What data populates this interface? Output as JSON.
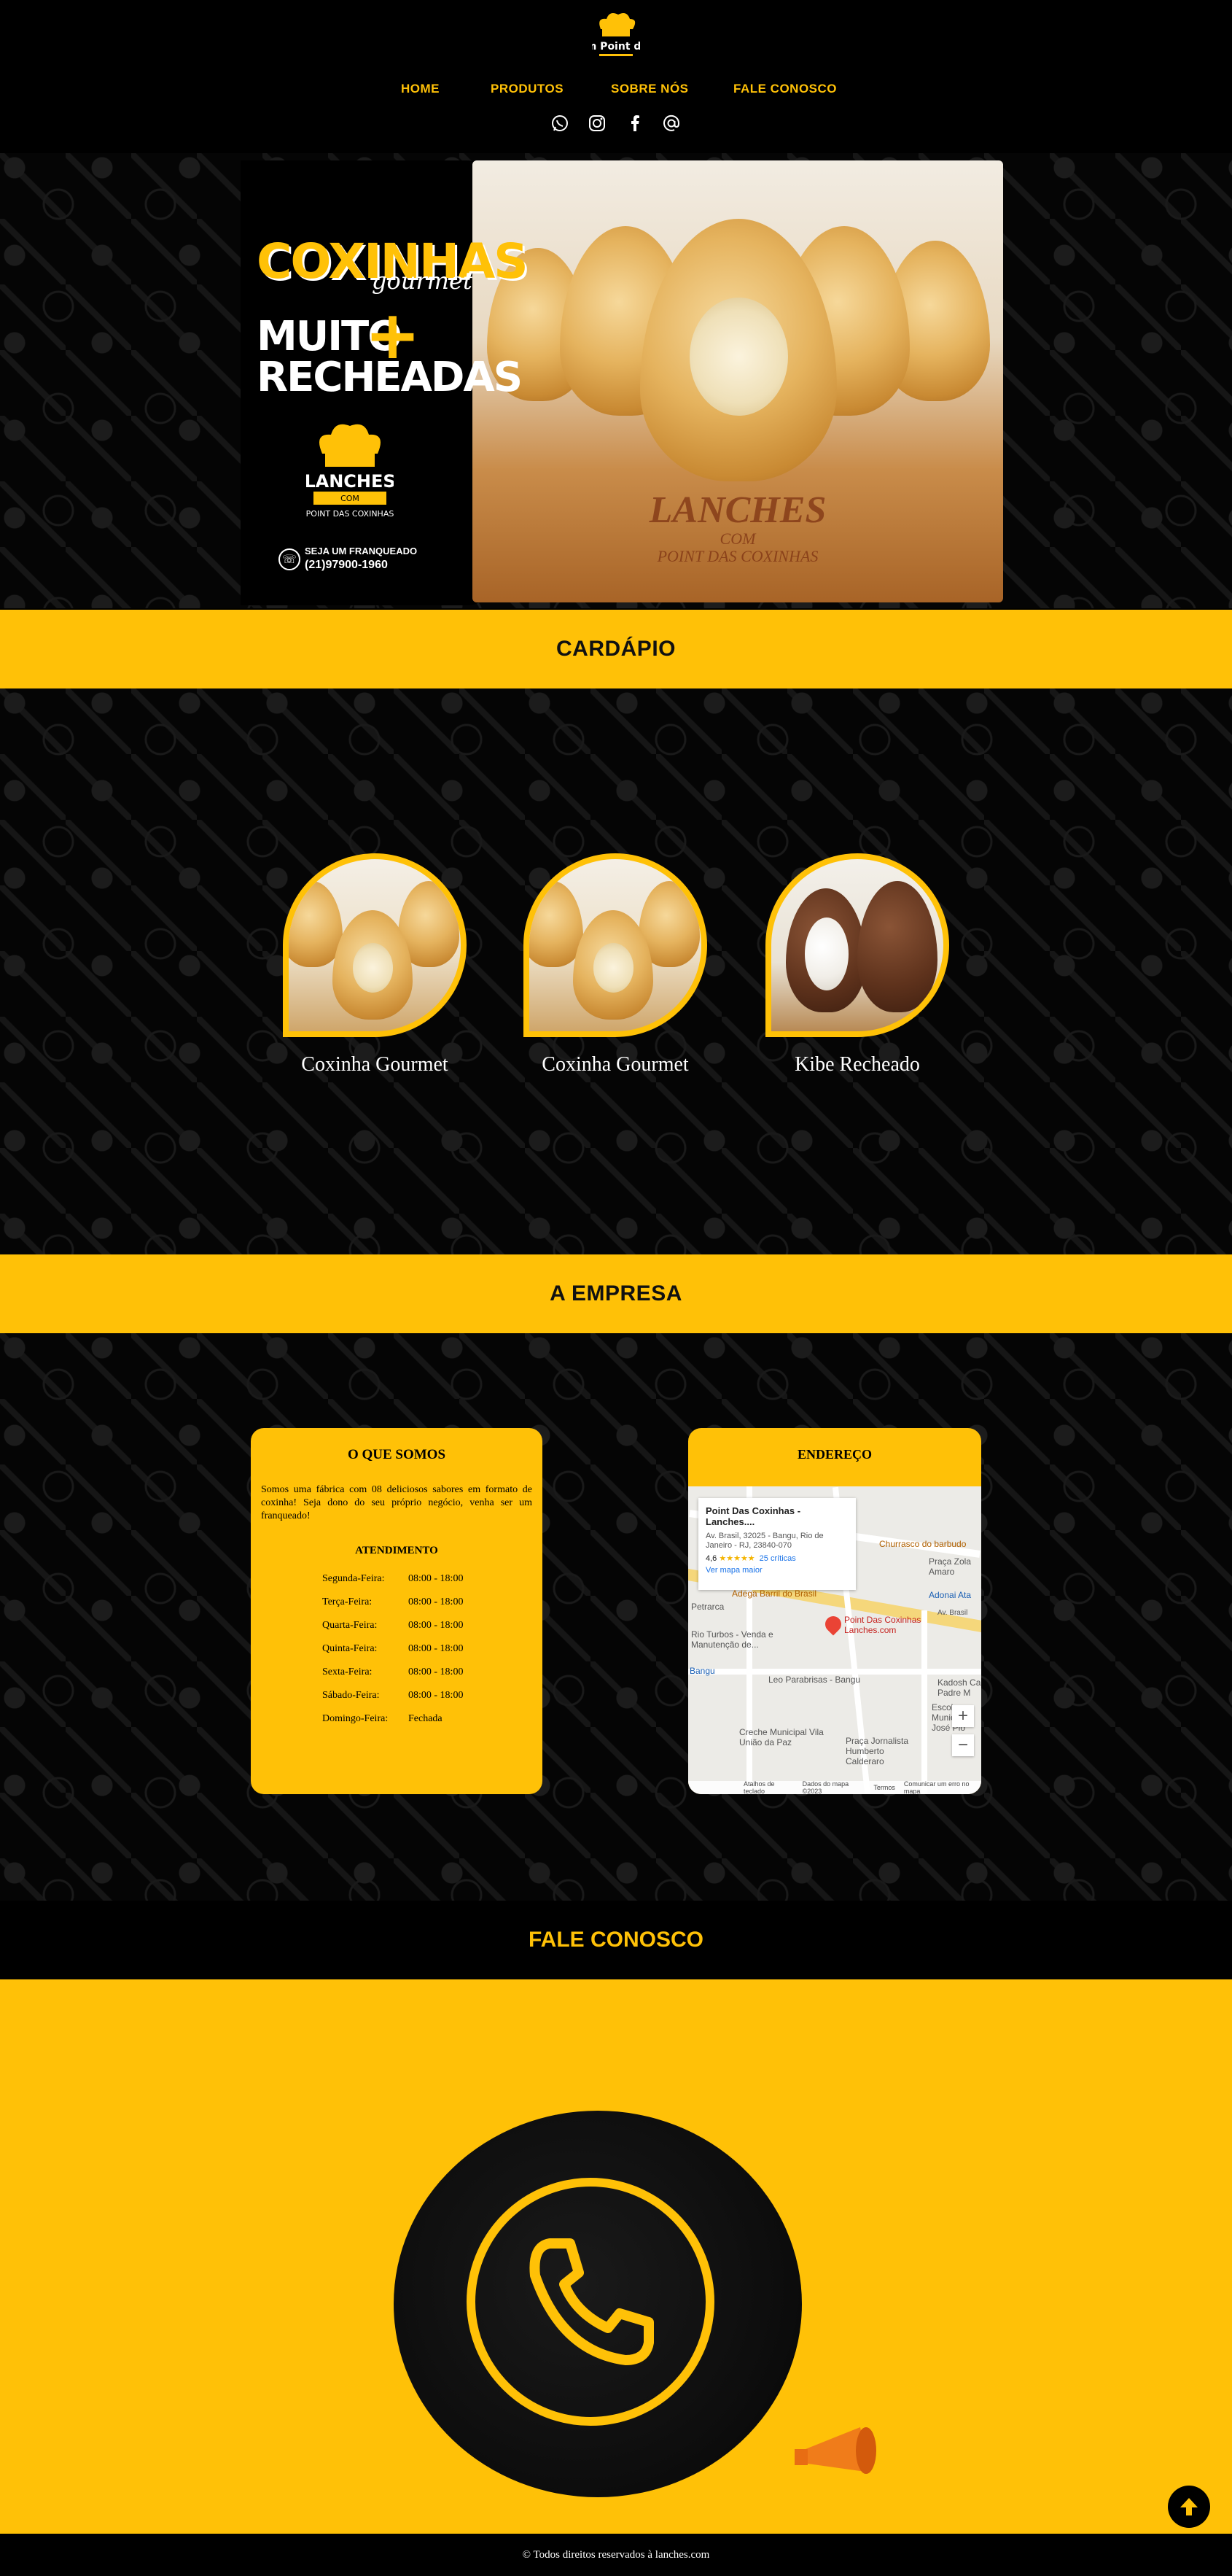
{
  "header": {
    "brand_logo": "Lanches com Point das Coxinhas",
    "nav": {
      "home": "HOME",
      "produtos": "PRODUTOS",
      "sobre": "SOBRE NÓS",
      "fale": "FALE CONOSCO"
    },
    "social_icons": [
      "whatsapp-icon",
      "instagram-icon",
      "facebook-icon",
      "at-icon"
    ]
  },
  "hero": {
    "title": "COXINHAS",
    "subtitle": "gourmet",
    "tagline_1": "MUITO",
    "tagline_plus": "+",
    "tagline_2": "RECHEADAS",
    "logo_word": "LANCHES",
    "logo_com": "COM",
    "logo_sub": "POINT DAS COXINHAS",
    "franchise_label": "SEJA UM FRANQUEADO",
    "franchise_phone": "(21)97900-1960",
    "photo_brand": "LANCHES",
    "photo_brand_com": "COM",
    "photo_brand_sub": "POINT DAS COXINHAS"
  },
  "cardapio": {
    "heading": "CARDÁPIO",
    "items": [
      {
        "name": "Coxinha Gourmet"
      },
      {
        "name": "Coxinha Gourmet"
      },
      {
        "name": "Kibe Recheado"
      }
    ]
  },
  "empresa": {
    "heading": "A EMPRESA",
    "about_title": "O QUE SOMOS",
    "about_text": "Somos uma fábrica com 08 deliciosos sabores em formato de coxinha! Seja dono do seu próprio negócio, venha ser um franqueado!",
    "hours_title": "ATENDIMENTO",
    "hours": [
      {
        "day": "Segunda-Feira:",
        "time": "08:00 - 18:00"
      },
      {
        "day": "Terça-Feira:",
        "time": "08:00 - 18:00"
      },
      {
        "day": "Quarta-Feira:",
        "time": "08:00 - 18:00"
      },
      {
        "day": "Quinta-Feira:",
        "time": "08:00 - 18:00"
      },
      {
        "day": "Sexta-Feira:",
        "time": "08:00 - 18:00"
      },
      {
        "day": "Sábado-Feira:",
        "time": "08:00 - 18:00"
      },
      {
        "day": "Domingo-Feira:",
        "time": "Fechada"
      }
    ],
    "address_title": "ENDEREÇO",
    "map": {
      "place_title": "Point Das Coxinhas - Lanches....",
      "place_address": "Av. Brasil, 32025 - Bangu, Rio de Janeiro - RJ, 23840-070",
      "rating": "4,6",
      "stars": "★★★★★",
      "reviews": "25 críticas",
      "larger_map": "Ver mapa maior",
      "labels": [
        "Petrarca",
        "Adega Barril do Brasil",
        "Churrasco do barbudo",
        "Praça Zola Amaro",
        "Adonai Ata",
        "Rio Turbos - Venda e Manutenção de...",
        "Leo Parabrisas - Bangu",
        "Point Das Coxinhas Lanches.com",
        "Creche Municipal Vila União da Paz",
        "Praça Jornalista Humberto Calderaro",
        "Escola Municipal José Pio",
        "Kadosh Ca Padre M",
        "Av. Brasil",
        "Bangu"
      ],
      "zoom_in": "+",
      "zoom_out": "−",
      "footer_keys": "Atalhos de teclado",
      "footer_data": "Dados do mapa ©2023",
      "footer_terms": "Termos",
      "footer_report": "Comunicar um erro no mapa"
    }
  },
  "fale": {
    "heading": "FALE CONOSCO"
  },
  "footer": {
    "copyright": "© Todos direitos reservados à lanches.com"
  },
  "colors": {
    "accent": "#ffc107",
    "dark": "#000000"
  }
}
